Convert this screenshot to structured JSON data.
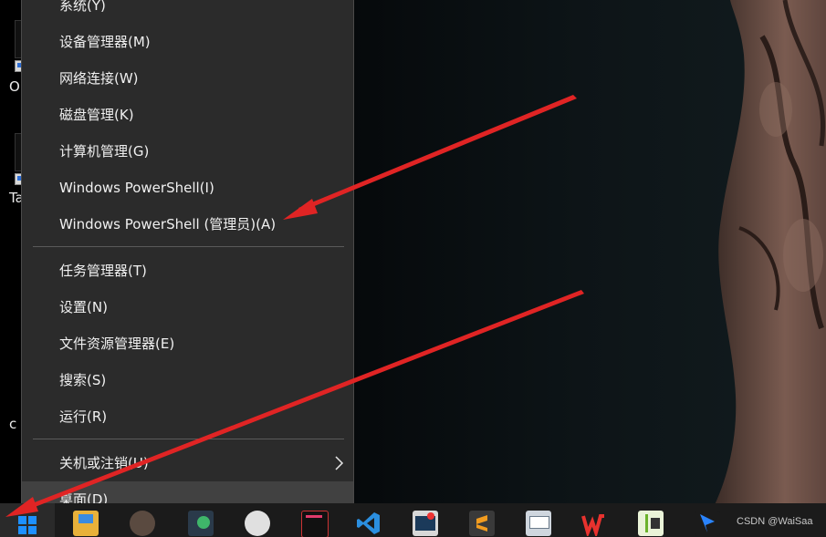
{
  "menu": {
    "items": [
      {
        "label": "系统(Y)"
      },
      {
        "label": "设备管理器(M)"
      },
      {
        "label": "网络连接(W)"
      },
      {
        "label": "磁盘管理(K)"
      },
      {
        "label": "计算机管理(G)"
      },
      {
        "label": "Windows PowerShell(I)"
      },
      {
        "label": "Windows PowerShell (管理员)(A)"
      },
      {
        "label": "任务管理器(T)"
      },
      {
        "label": "设置(N)"
      },
      {
        "label": "文件资源管理器(E)"
      },
      {
        "label": "搜索(S)"
      },
      {
        "label": "运行(R)"
      },
      {
        "label": "关机或注销(U)"
      },
      {
        "label": "桌面(D)"
      }
    ]
  },
  "desktop": {
    "labels": [
      "O",
      "Ta",
      "c"
    ]
  },
  "taskbar": {
    "icons": [
      "start-windows-icon",
      "file-explorer-icon",
      "game-character-icon",
      "app-icon",
      "chat-icon",
      "jetbrains-icon",
      "vscode-icon",
      "cmd-terminal-icon",
      "sublime-text-icon",
      "monitor-app-icon",
      "wps-office-icon",
      "notepad-plus-plus-icon",
      "feishu-icon"
    ],
    "watermark": "CSDN @WaiSaa"
  },
  "colors": {
    "menu_bg": "#2b2b2b",
    "menu_hover": "#414141",
    "annotation_arrow": "#e02424",
    "taskbar_bg": "#1b1b1b"
  }
}
